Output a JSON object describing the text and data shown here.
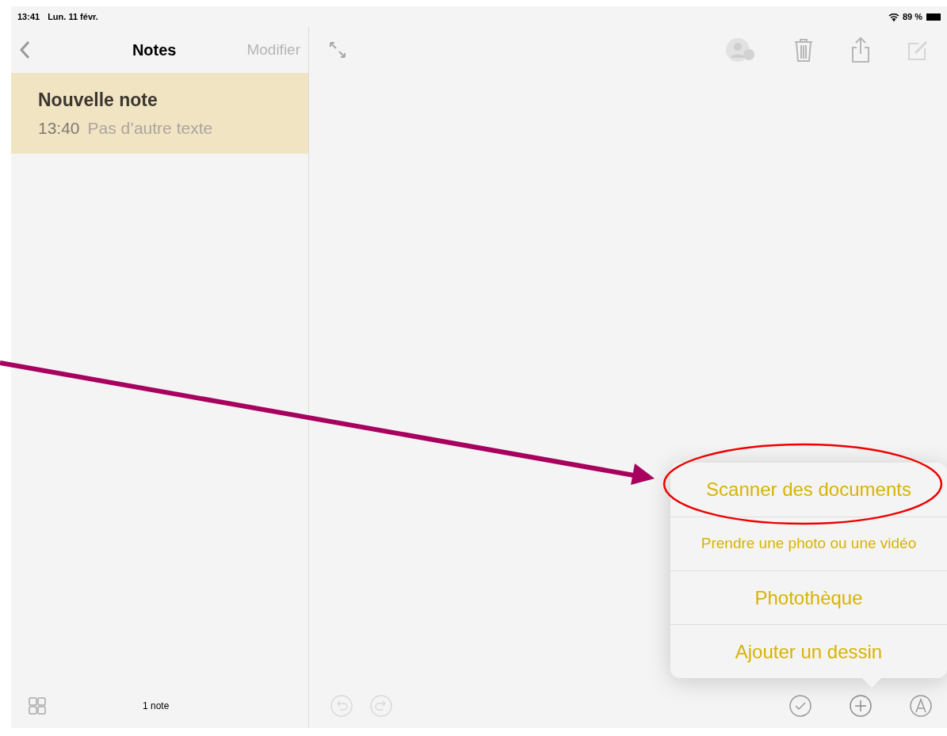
{
  "status_bar": {
    "time": "13:41",
    "date": "Lun. 11 févr.",
    "battery": "89 %"
  },
  "sidebar": {
    "title": "Notes",
    "edit": "Modifier",
    "notes": [
      {
        "title": "Nouvelle note",
        "time": "13:40",
        "preview": "Pas d’autre texte",
        "selected": true
      }
    ],
    "count": "1 note"
  },
  "popover": {
    "items": [
      {
        "label": "Scanner des documents",
        "highlighted": true
      },
      {
        "label": "Prendre une photo ou une vidéo",
        "highlighted": false
      },
      {
        "label": "Photothèque",
        "highlighted": false
      },
      {
        "label": "Ajouter un dessin",
        "highlighted": false
      }
    ]
  }
}
